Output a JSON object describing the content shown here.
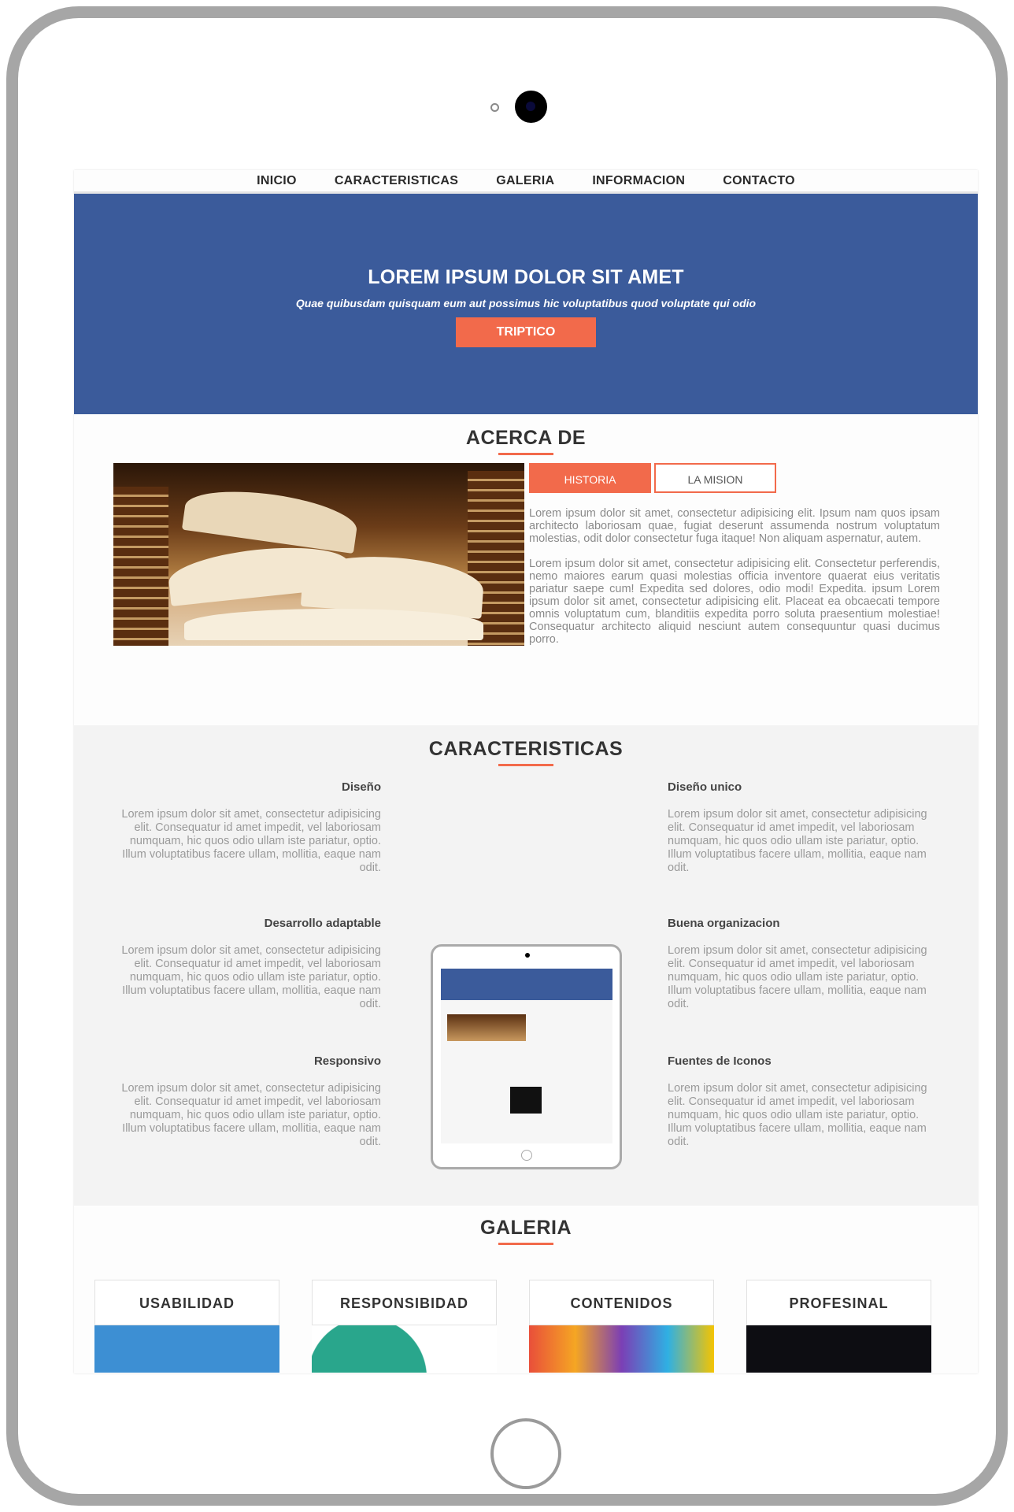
{
  "nav": [
    "INICIO",
    "CARACTERISTICAS",
    "GALERIA",
    "INFORMACION",
    "CONTACTO"
  ],
  "hero": {
    "title": "LOREM IPSUM DOLOR SIT AMET",
    "subtitle": "Quae quibusdam quisquam eum aut possimus hic voluptatibus quod voluptate qui odio",
    "button": "TRIPTICO"
  },
  "about": {
    "title": "ACERCA DE",
    "tabs": [
      "HISTORIA",
      "LA MISION"
    ],
    "p1": "Lorem ipsum dolor sit amet, consectetur adipisicing elit. Ipsum nam quos ipsam architecto laboriosam quae, fugiat deserunt assumenda nostrum voluptatum molestias, odit dolor consectetur fuga itaque! Non aliquam aspernatur, autem.",
    "p2": "Lorem ipsum dolor sit amet, consectetur adipisicing elit. Consectetur perferendis, nemo maiores earum quasi molestias officia inventore quaerat eius veritatis pariatur saepe cum! Expedita sed dolores, odio modi! Expedita. ipsum Lorem ipsum dolor sit amet, consectetur adipisicing elit. Placeat ea obcaecati tempore omnis voluptatum cum, blanditiis expedita porro soluta praesentium molestiae! Consequatur architecto aliquid nesciunt autem consequuntur quasi ducimus porro."
  },
  "features": {
    "title": "CARACTERISTICAS",
    "left": [
      {
        "title": "Diseño",
        "text": "Lorem ipsum dolor sit amet, consectetur adipisicing elit. Consequatur id amet impedit, vel laboriosam numquam, hic quos odio ullam iste pariatur, optio. Illum voluptatibus facere ullam, mollitia, eaque nam odit."
      },
      {
        "title": "Desarrollo adaptable",
        "text": "Lorem ipsum dolor sit amet, consectetur adipisicing elit. Consequatur id amet impedit, vel laboriosam numquam, hic quos odio ullam iste pariatur, optio. Illum voluptatibus facere ullam, mollitia, eaque nam odit."
      },
      {
        "title": "Responsivo",
        "text": "Lorem ipsum dolor sit amet, consectetur adipisicing elit. Consequatur id amet impedit, vel laboriosam numquam, hic quos odio ullam iste pariatur, optio. Illum voluptatibus facere ullam, mollitia, eaque nam odit."
      }
    ],
    "right": [
      {
        "title": "Diseño unico",
        "text": "Lorem ipsum dolor sit amet, consectetur adipisicing elit. Consequatur id amet impedit, vel laboriosam numquam, hic quos odio ullam iste pariatur, optio. Illum voluptatibus facere ullam, mollitia, eaque nam odit."
      },
      {
        "title": "Buena organizacion",
        "text": "Lorem ipsum dolor sit amet, consectetur adipisicing elit. Consequatur id amet impedit, vel laboriosam numquam, hic quos odio ullam iste pariatur, optio. Illum voluptatibus facere ullam, mollitia, eaque nam odit."
      },
      {
        "title": "Fuentes de Iconos",
        "text": "Lorem ipsum dolor sit amet, consectetur adipisicing elit. Consequatur id amet impedit, vel laboriosam numquam, hic quos odio ullam iste pariatur, optio. Illum voluptatibus facere ullam, mollitia, eaque nam odit."
      }
    ]
  },
  "gallery": {
    "title": "GALERIA",
    "cards": [
      "USABILIDAD",
      "RESPONSIBIDAD",
      "CONTENIDOS",
      "PROFESINAL"
    ]
  },
  "colors": {
    "hero_bg": "#3b5b9b",
    "accent": "#f26a4b",
    "frame": "#a6a6a6"
  }
}
